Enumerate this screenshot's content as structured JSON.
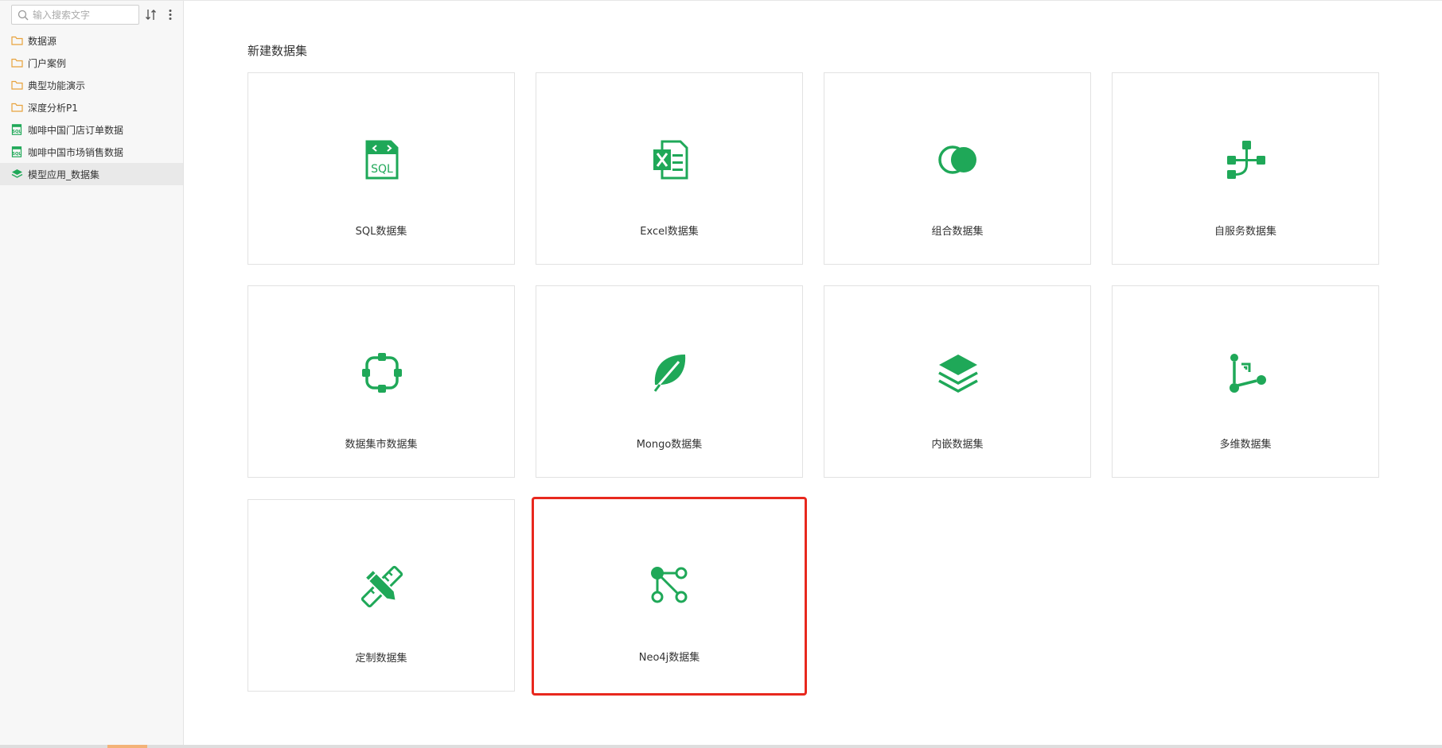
{
  "sidebar": {
    "search_placeholder": "输入搜索文字",
    "items": [
      {
        "label": "数据源",
        "icon": "folder-icon"
      },
      {
        "label": "门户案例",
        "icon": "folder-icon"
      },
      {
        "label": "典型功能演示",
        "icon": "folder-icon"
      },
      {
        "label": "深度分析P1",
        "icon": "folder-icon"
      },
      {
        "label": "咖啡中国门店订单数据",
        "icon": "sql-file-icon"
      },
      {
        "label": "咖啡中国市场销售数据",
        "icon": "sql-file-icon"
      },
      {
        "label": "模型应用_数据集",
        "icon": "layers-icon",
        "selected": true
      }
    ]
  },
  "main": {
    "title": "新建数据集",
    "cards": [
      {
        "label": "SQL数据集",
        "icon": "sql-icon"
      },
      {
        "label": "Excel数据集",
        "icon": "excel-icon"
      },
      {
        "label": "组合数据集",
        "icon": "combine-circles-icon"
      },
      {
        "label": "自服务数据集",
        "icon": "flow-nodes-icon"
      },
      {
        "label": "数据集市数据集",
        "icon": "focus-nodes-icon"
      },
      {
        "label": "Mongo数据集",
        "icon": "leaf-icon"
      },
      {
        "label": "内嵌数据集",
        "icon": "stack-layers-icon"
      },
      {
        "label": "多维数据集",
        "icon": "multidim-axis-icon"
      },
      {
        "label": "定制数据集",
        "icon": "pencil-ruler-icon"
      },
      {
        "label": "Neo4j数据集",
        "icon": "graph-nodes-icon",
        "highlighted": true
      }
    ]
  },
  "colors": {
    "accent": "#1fa858",
    "folder": "#e8a33d",
    "highlight": "#e8281e"
  }
}
